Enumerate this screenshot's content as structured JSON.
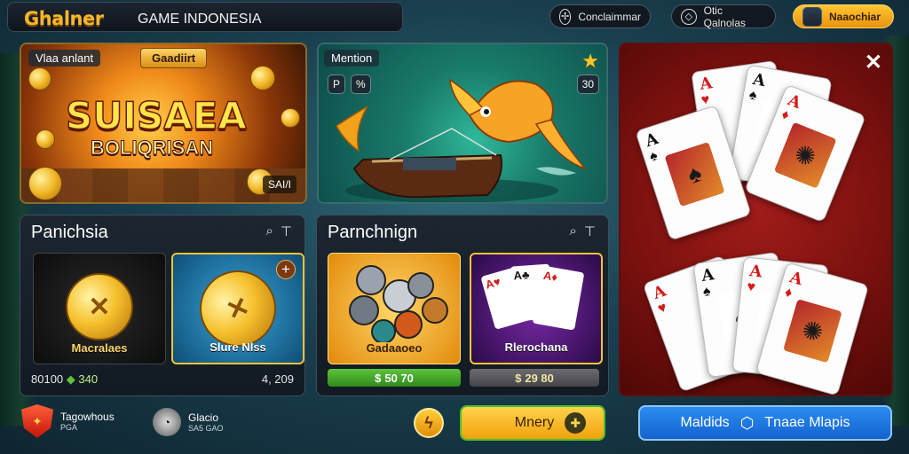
{
  "topbar": {
    "logo": "Ghalner",
    "subtitle": "GAME INDONESIA",
    "pill_1": "Conclaimmar",
    "pill_2": "Otic Qalnolas",
    "pill_3": "Naaochiar"
  },
  "slot_panel": {
    "tab_label": "Vlaa anlant",
    "ribbon": "Gaadiirt",
    "title": "SUISAEA",
    "subtitle": "BOLIQRISAN",
    "corner": "SAI/I"
  },
  "fish_panel": {
    "tab_label": "Mention",
    "ctrl_1": "P",
    "ctrl_2": "%",
    "ctrl_3": "30"
  },
  "left_panel": {
    "title": "Panichsia",
    "tile_1_label": "Macralaes",
    "tile_2_label": "Slure Nlss",
    "stat_left": "80100",
    "stat_mid": "340",
    "stat_right": "4, 209"
  },
  "mid_panel": {
    "title": "Parnchnign",
    "tile_1_label": "Gadaaoeo",
    "tile_2_label": "Rlerochana",
    "bar_1": "50 70",
    "bar_2": "29 80"
  },
  "bottom": {
    "item_1_title": "Tagowhous",
    "item_1_sub": "PGA",
    "item_2_title": "Glacio",
    "item_2_sub": "SA5 GAO",
    "cta_1": "Mnery",
    "cta_2_left": "Maldids",
    "cta_2_right": "Tnaae Mlapis"
  },
  "icons": {
    "pill_1_icon": "compass-icon",
    "pill_2_icon": "diamond-icon",
    "close": "close-icon"
  },
  "colors": {
    "gold": "#f6b72a",
    "cta_blue": "#1e7ae6",
    "green": "#4cbf2c",
    "card_red": "#a31d1a"
  }
}
